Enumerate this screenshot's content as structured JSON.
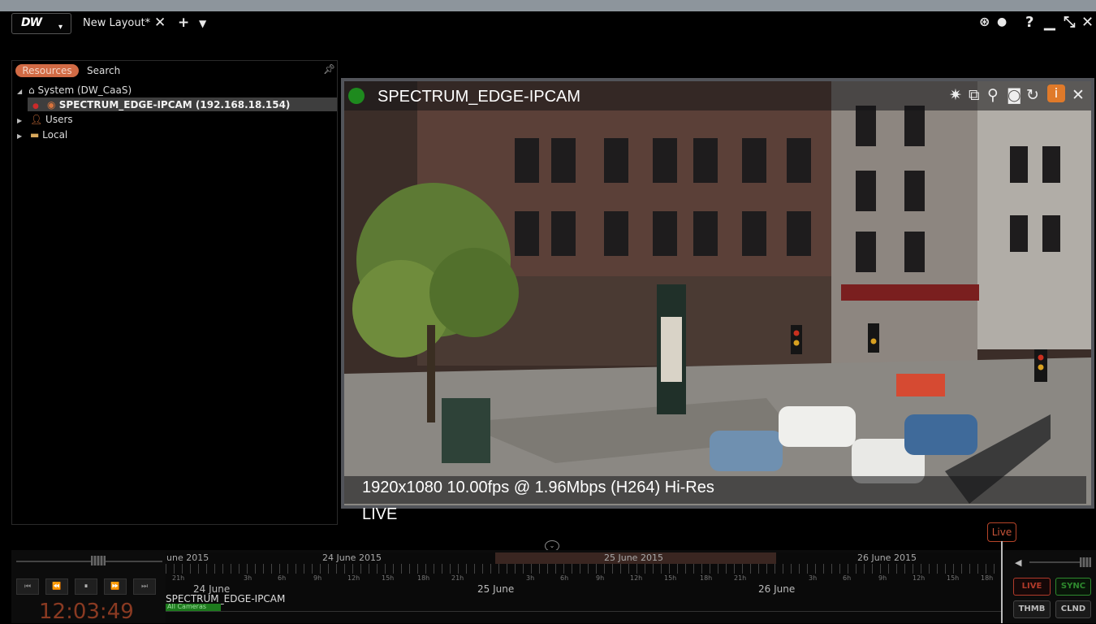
{
  "titlebar": {
    "logo": "DW",
    "tab_label": "New Layout*",
    "close_tab": "✕",
    "add_tab": "+",
    "tab_menu": "▼",
    "help": "?",
    "minimize": "▁",
    "restore": "⤡",
    "close": "✕"
  },
  "left_panel": {
    "tabs": [
      "Resources",
      "Search"
    ],
    "tree": {
      "system": "System (DW_CaaS)",
      "camera": "SPECTRUM_EDGE-IPCAM (192.168.18.154)",
      "users": "Users",
      "local": "Local"
    }
  },
  "camera": {
    "name": "SPECTRUM_EDGE-IPCAM",
    "info": "1920x1080  10.00fps @ 1.96Mbps (H264)  Hi-Res",
    "mode": "LIVE",
    "status_color": "#1e8a1e"
  },
  "timeline": {
    "dates": [
      "une 2015",
      "24 June 2015",
      "25 June 2015",
      "26 June 2015"
    ],
    "hours": [
      "21h",
      "3h",
      "6h",
      "9h",
      "12h",
      "15h",
      "18h",
      "21h",
      "3h",
      "6h",
      "9h",
      "12h",
      "15h",
      "18h",
      "21h",
      "3h",
      "6h",
      "9h",
      "12h",
      "15h",
      "18h"
    ],
    "days": [
      "24 June",
      "25 June",
      "26 June"
    ],
    "camera_row": "SPECTRUM_EDGE-IPCAM",
    "all_cameras": "All Cameras",
    "live_marker": "Live"
  },
  "playback": {
    "clock": "12:03:49"
  },
  "buttons": {
    "live": "LIVE",
    "sync": "SYNC",
    "thmb": "THMB",
    "clnd": "CLND"
  }
}
